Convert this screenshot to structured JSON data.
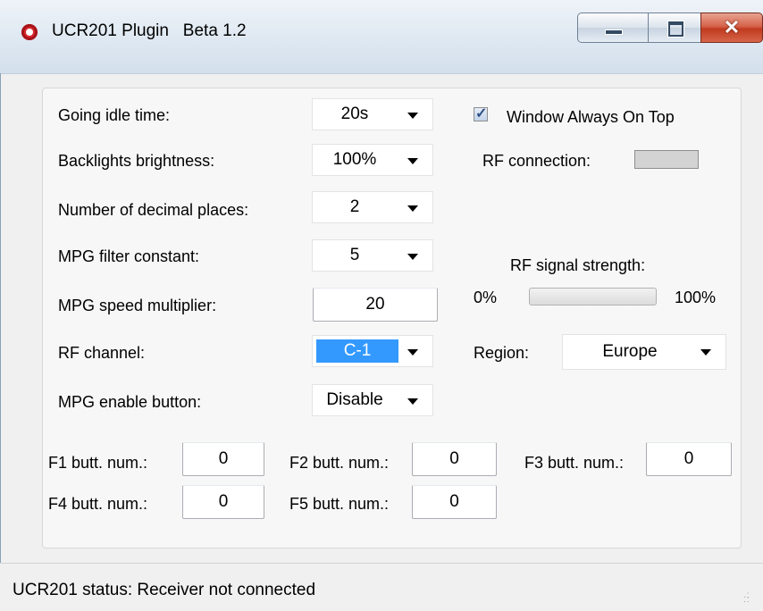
{
  "window": {
    "title": "UCR201 Plugin   Beta 1.2",
    "controls": {
      "minimize": "minimize",
      "maximize": "maximize",
      "close": "✕"
    }
  },
  "settings": {
    "idle_time": {
      "label": "Going idle time:",
      "value": "20s"
    },
    "backlight": {
      "label": "Backlights brightness:",
      "value": "100%"
    },
    "decimals": {
      "label": "Number of decimal places:",
      "value": "2"
    },
    "mpg_filter": {
      "label": "MPG filter constant:",
      "value": "5"
    },
    "mpg_speed": {
      "label": "MPG speed multiplier:",
      "value": "20"
    },
    "rf_channel": {
      "label": "RF channel:",
      "value": "C-1"
    },
    "mpg_enable": {
      "label": "MPG enable button:",
      "value": "Disable"
    }
  },
  "right_panel": {
    "always_on_top": {
      "label": "Window Always On Top",
      "checked": true
    },
    "rf_connection": {
      "label": "RF connection:",
      "indicator_color": "#d3d3d3"
    },
    "rf_signal": {
      "label": "RF signal strength:",
      "min_label": "0%",
      "max_label": "100%",
      "value_percent": 0
    },
    "region": {
      "label": "Region:",
      "value": "Europe"
    }
  },
  "function_buttons": [
    {
      "label": "F1 butt. num.:",
      "value": "0"
    },
    {
      "label": "F2 butt. num.:",
      "value": "0"
    },
    {
      "label": "F3 butt. num.:",
      "value": "0"
    },
    {
      "label": "F4 butt. num.:",
      "value": "0"
    },
    {
      "label": "F5 butt. num.:",
      "value": "0"
    }
  ],
  "statusbar": {
    "text": "UCR201 status: Receiver not connected"
  },
  "colors": {
    "selection": "#3399ff",
    "close_button": "#c13a1f",
    "app_icon": "#d8272e"
  }
}
